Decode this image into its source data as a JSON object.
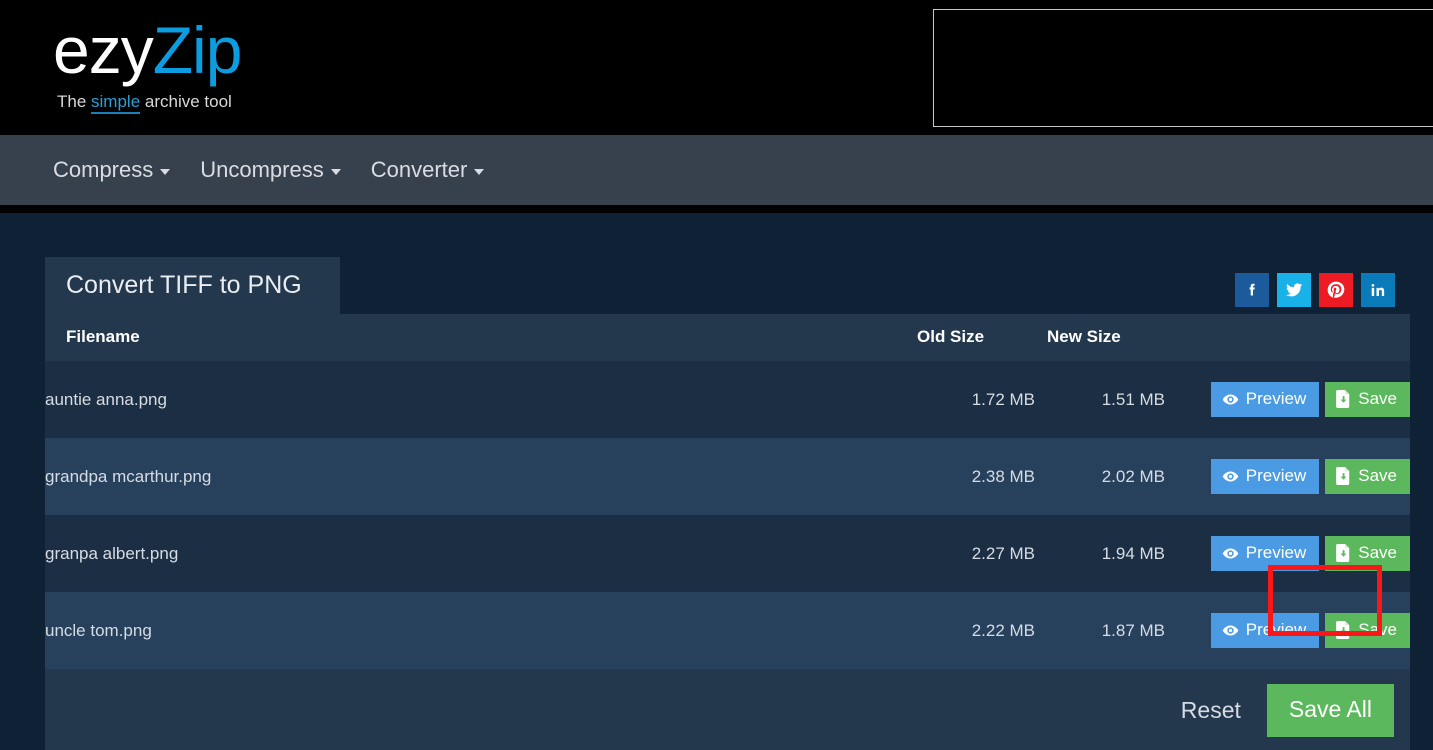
{
  "brand": {
    "name_primary": "ezy",
    "name_secondary": "Zip",
    "tagline_before": "The ",
    "tagline_link": "simple",
    "tagline_after": " archive tool",
    "primary_color": "#ffffff",
    "accent_color": "#0c9ce0"
  },
  "ad": {
    "label": ""
  },
  "nav": {
    "items": [
      {
        "label": "Compress",
        "icon": "chevron-down-icon"
      },
      {
        "label": "Uncompress",
        "icon": "chevron-down-icon"
      },
      {
        "label": "Converter",
        "icon": "chevron-down-icon"
      }
    ]
  },
  "panel": {
    "title": "Convert TIFF to PNG"
  },
  "social": {
    "items": [
      {
        "name": "facebook",
        "label": "f",
        "color": "#1b5a9b"
      },
      {
        "name": "twitter",
        "label": "",
        "color": "#19b2e8"
      },
      {
        "name": "pinterest",
        "label": "",
        "color": "#ec1b24"
      },
      {
        "name": "linkedin",
        "label": "in",
        "color": "#0a7bb8"
      }
    ]
  },
  "table": {
    "headers": {
      "filename": "Filename",
      "old_size": "Old Size",
      "new_size": "New Size",
      "actions": ""
    },
    "rows": [
      {
        "filename": "auntie anna.png",
        "old_size": "1.72 MB",
        "new_size": "1.51 MB",
        "preview_label": "Preview",
        "save_label": "Save",
        "highlighted": true
      },
      {
        "filename": "grandpa mcarthur.png",
        "old_size": "2.38 MB",
        "new_size": "2.02 MB",
        "preview_label": "Preview",
        "save_label": "Save",
        "highlighted": false
      },
      {
        "filename": "granpa albert.png",
        "old_size": "2.27 MB",
        "new_size": "1.94 MB",
        "preview_label": "Preview",
        "save_label": "Save",
        "highlighted": false
      },
      {
        "filename": "uncle tom.png",
        "old_size": "2.22 MB",
        "new_size": "1.87 MB",
        "preview_label": "Preview",
        "save_label": "Save",
        "highlighted": false
      }
    ]
  },
  "footer": {
    "reset_label": "Reset",
    "save_all_label": "Save All"
  },
  "highlight": {
    "color": "#fb1717",
    "target": "save-button-row-1"
  }
}
